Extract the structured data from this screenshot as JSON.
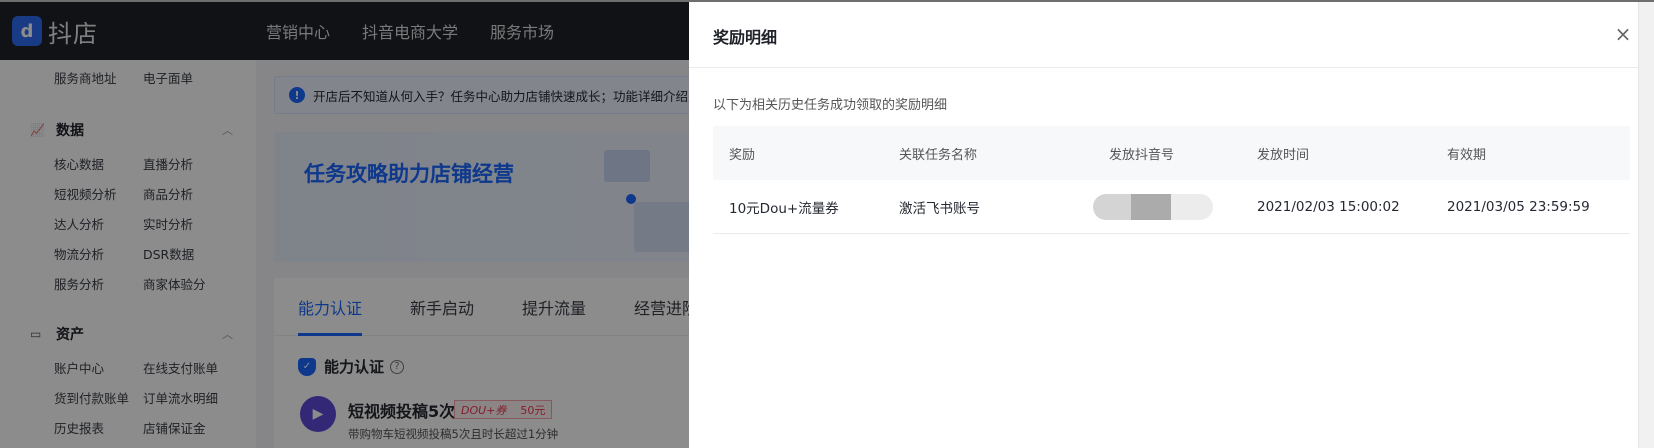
{
  "topbar": {
    "logo_mark": "d",
    "logo_text": "抖店",
    "nav": [
      "营销中心",
      "抖音电商大学",
      "服务市场"
    ]
  },
  "sidebar": {
    "top_items": [
      "服务商地址",
      "电子面单"
    ],
    "sections": [
      {
        "title": "数据",
        "items": [
          "核心数据",
          "直播分析",
          "短视频分析",
          "商品分析",
          "达人分析",
          "实时分析",
          "物流分析",
          "DSR数据",
          "服务分析",
          "商家体验分"
        ]
      },
      {
        "title": "资产",
        "items": [
          "账户中心",
          "在线支付账单",
          "货到付款账单",
          "订单流水明细",
          "历史报表",
          "店铺保证金"
        ]
      }
    ]
  },
  "main": {
    "notice": "开店后不知道从何入手？任务中心助力店铺快速成长；功能详细介绍点击",
    "banner_title": "任务攻略助力店铺经营",
    "tabs": [
      "能力认证",
      "新手启动",
      "提升流量",
      "经营进阶"
    ],
    "section_title": "能力认证",
    "task": {
      "name": "短视频投稿5次",
      "badge_tag": "DOU+券",
      "badge_value": "50元",
      "desc": "带购物车短视频投稿5次且时长超过1分钟"
    }
  },
  "drawer": {
    "title": "奖励明细",
    "subtitle": "以下为相关历史任务成功领取的奖励明细",
    "columns": [
      "奖励",
      "关联任务名称",
      "发放抖音号",
      "发放时间",
      "有效期"
    ],
    "rows": [
      {
        "reward": "10元Dou+流量券",
        "task": "激活飞书账号",
        "issue_time": "2021/02/03 15:00:02",
        "expiry": "2021/03/05 23:59:59"
      }
    ]
  },
  "colors": {
    "accent": "#1966ff",
    "topbar": "#1f2229",
    "badge_red": "#e8384f"
  }
}
